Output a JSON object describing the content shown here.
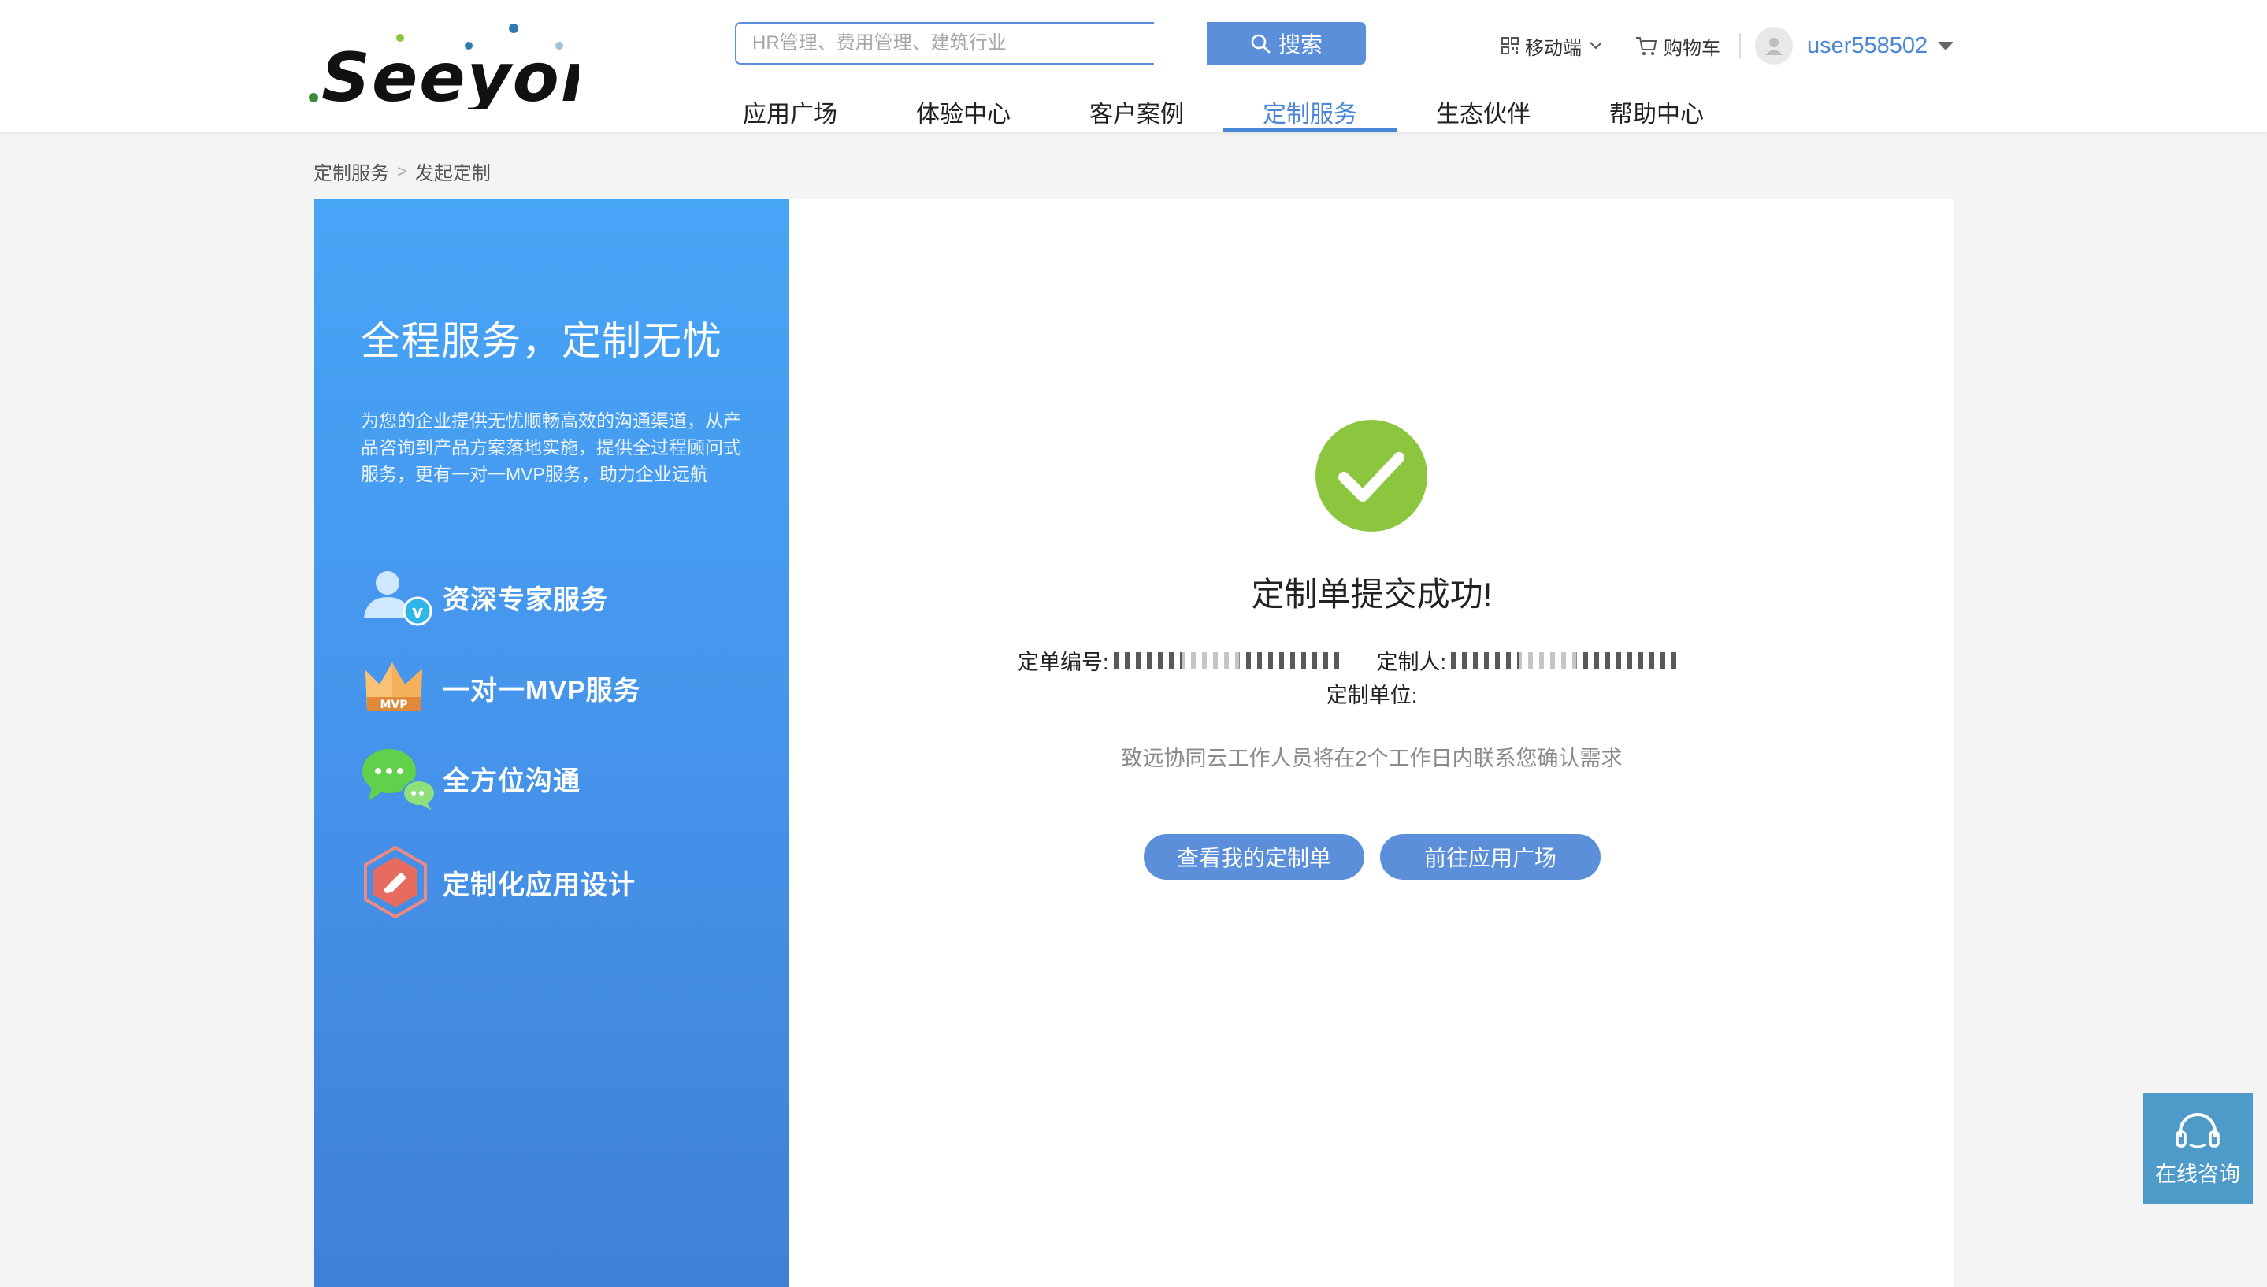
{
  "header": {
    "logo_text": "Seeyon",
    "search": {
      "placeholder": "HR管理、费用管理、建筑行业",
      "button_label": "搜索"
    },
    "nav": [
      {
        "label": "应用广场",
        "active": false
      },
      {
        "label": "体验中心",
        "active": false
      },
      {
        "label": "客户案例",
        "active": false
      },
      {
        "label": "定制服务",
        "active": true
      },
      {
        "label": "生态伙伴",
        "active": false
      },
      {
        "label": "帮助中心",
        "active": false
      }
    ],
    "mobile_label": "移动端",
    "cart_label": "购物车",
    "username": "user558502"
  },
  "breadcrumb": {
    "parent": "定制服务",
    "separator": ">",
    "current": "发起定制"
  },
  "left_panel": {
    "title": "全程服务，定制无忧",
    "description": "为您的企业提供无忧顺畅高效的沟通渠道，从产品咨询到产品方案落地实施，提供全过程顾问式服务，更有一对一MVP服务，助力企业远航",
    "features": [
      {
        "icon": "expert-icon",
        "label": "资深专家服务"
      },
      {
        "icon": "crown-mvp-icon",
        "label": "一对一MVP服务"
      },
      {
        "icon": "chat-bubbles-icon",
        "label": "全方位沟通"
      },
      {
        "icon": "design-hexagon-icon",
        "label": "定制化应用设计"
      }
    ],
    "crown_text": "MVP"
  },
  "result": {
    "title": "定制单提交成功!",
    "order_no_label": "定单编号:",
    "customizer_label": "定制人:",
    "unit_label": "定制单位:",
    "note": "致远协同云工作人员将在2个工作日内联系您确认需求",
    "btn_view": "查看我的定制单",
    "btn_go": "前往应用广场"
  },
  "consult": {
    "label": "在线咨询"
  },
  "colors": {
    "primary": "#5b8fd9",
    "success": "#8cc63f",
    "panel_blue": "#4592ea",
    "consult_bg": "#4e9ac8"
  }
}
